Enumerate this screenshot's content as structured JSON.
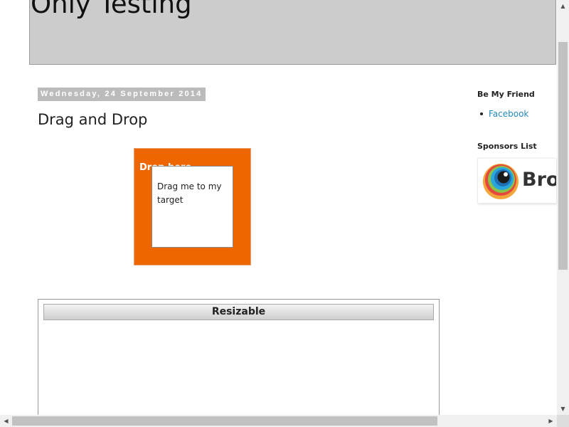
{
  "header": {
    "blog_title": "Only Testing"
  },
  "post": {
    "date": "Wednesday, 24 September 2014",
    "title": "Drag and Drop",
    "droppable_label": "Drop here",
    "draggable_text": "Drag me to my target",
    "resizable_header": "Resizable"
  },
  "sidebar": {
    "friend_heading": "Be My Friend",
    "friend_links": [
      "Facebook"
    ],
    "sponsors_heading": "Sponsors List",
    "sponsor_text": "Brow"
  },
  "scrollbars": {
    "up_arrow": "▲",
    "down_arrow": "▼",
    "left_arrow": "◀",
    "right_arrow": "▶"
  },
  "colors": {
    "header_bg": "#cccccc",
    "droppable_bg": "#ee6600",
    "link": "#2288bb",
    "date_bg": "#bbbbbb"
  }
}
